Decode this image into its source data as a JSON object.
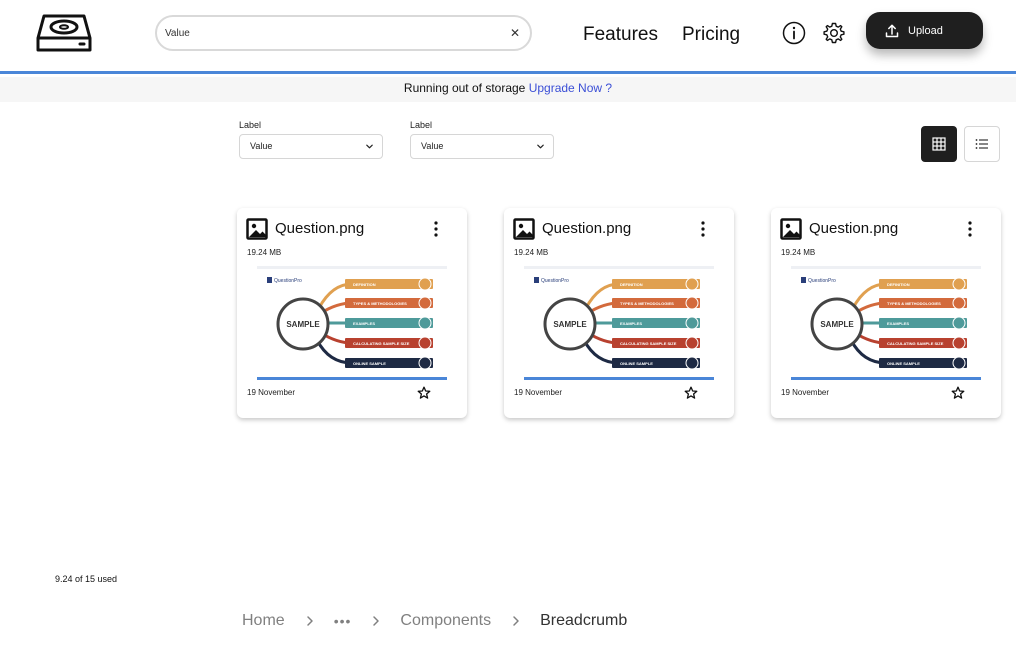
{
  "header": {
    "search": {
      "value": "Value",
      "placeholder": "Value"
    },
    "nav": {
      "features": "Features",
      "pricing": "Pricing"
    },
    "upload_label": "Upload"
  },
  "banner": {
    "text": "Running out of storage ",
    "link": "Upgrade Now ?"
  },
  "filters": [
    {
      "label": "Label",
      "value": "Value"
    },
    {
      "label": "Label",
      "value": "Value"
    }
  ],
  "view_mode": "grid",
  "cards": [
    {
      "title": "Question.png",
      "size": "19.24 MB",
      "date": "19 November"
    },
    {
      "title": "Question.png",
      "size": "19.24 MB",
      "date": "19 November"
    },
    {
      "title": "Question.png",
      "size": "19.24 MB",
      "date": "19 November"
    }
  ],
  "thumbnail": {
    "brand": "QuestionPro",
    "center": "SAMPLE",
    "items": [
      {
        "label": "DEFINITION",
        "color": "#e0a050"
      },
      {
        "label": "TYPES & METHODOLOGIES",
        "color": "#d36a3c"
      },
      {
        "label": "EXAMPLES",
        "color": "#4e9a9a"
      },
      {
        "label": "CALCULATING SAMPLE SIZE",
        "color": "#b8412f"
      },
      {
        "label": "ONLINE SAMPLE",
        "color": "#1e2a44"
      }
    ]
  },
  "storage": {
    "text": "9.24 of 15 used"
  },
  "breadcrumb": {
    "home": "Home",
    "ellipsis": "•••",
    "components": "Components",
    "current": "Breadcrumb"
  },
  "colors": {
    "accent_line": "#4a86d8",
    "link": "#3b4fd6",
    "dark_button": "#1f1f1f"
  }
}
